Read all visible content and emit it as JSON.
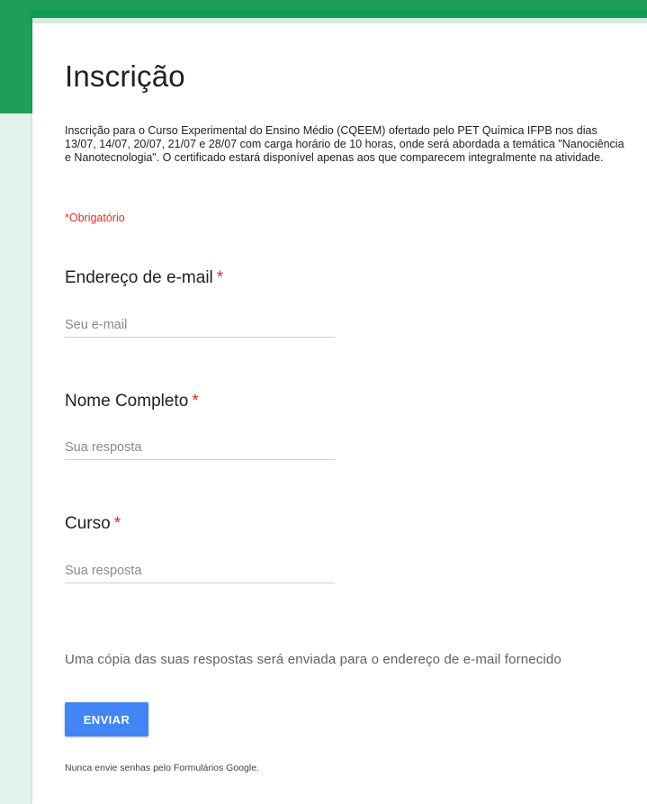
{
  "form": {
    "title": "Inscrição",
    "description": "Inscrição para o Curso Experimental do Ensino Médio (CQEEM) ofertado pelo PET Química IFPB nos dias 13/07, 14/07, 20/07, 21/07 e 28/07 com carga horário de 10 horas, onde será abordada a temática \"Nanociência e Nanotecnologia\". O certificado estará disponível apenas aos que comparecem integralmente na atividade.",
    "required_note": "*Obrigatório"
  },
  "questions": [
    {
      "label": "Endereço de e-mail",
      "required_marker": "*",
      "placeholder": "Seu e-mail"
    },
    {
      "label": "Nome Completo",
      "required_marker": "*",
      "placeholder": "Sua resposta"
    },
    {
      "label": "Curso",
      "required_marker": "*",
      "placeholder": "Sua resposta"
    }
  ],
  "copy_note": "Uma cópia das suas respostas será enviada para o endereço de e-mail fornecido",
  "submit_label": "ENVIAR",
  "footer_note": "Nunca envie senhas pelo Formulários Google.",
  "colors": {
    "header_green": "#1e9e59",
    "background_mint": "#e0f2ea",
    "required_red": "#d93025",
    "button_blue": "#4285f4"
  }
}
